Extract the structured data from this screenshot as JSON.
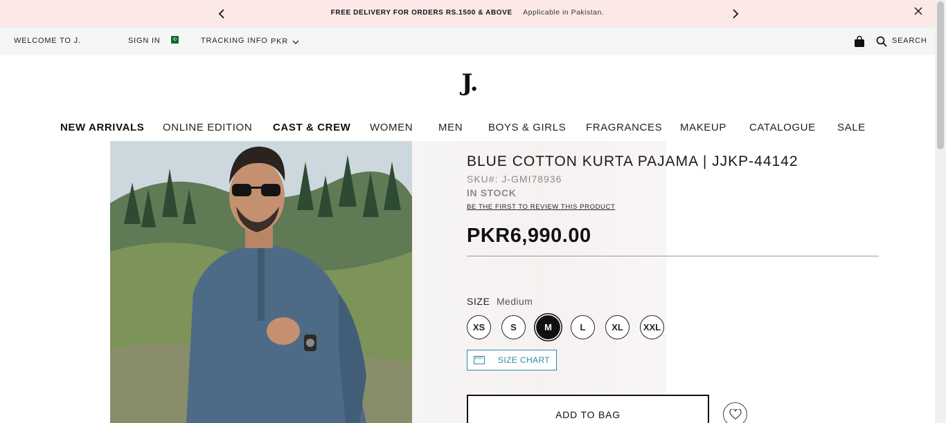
{
  "promo": {
    "message_bold": "FREE DELIVERY FOR ORDERS RS.1500 & ABOVE",
    "message_light": "Applicable in Pakistan.",
    "prev_icon": "chevron-left-icon",
    "next_icon": "chevron-right-icon",
    "close_icon": "close-icon",
    "background": "#fde8e8"
  },
  "utility": {
    "welcome": "WELCOME TO J.",
    "sign_in": "SIGN IN",
    "flag_icon": "pakistan-flag-icon",
    "tracking": "TRACKING INFO",
    "currency": "PKR",
    "bag_icon": "shopping-bag-icon",
    "search_icon": "search-icon",
    "search_label": "SEARCH"
  },
  "logo": "J.",
  "nav": [
    {
      "label": "NEW ARRIVALS",
      "bold": true
    },
    {
      "label": "ONLINE EDITION",
      "bold": false
    },
    {
      "label": "CAST & CREW",
      "bold": true
    },
    {
      "label": "WOMEN",
      "bold": false
    },
    {
      "label": "MEN",
      "bold": false
    },
    {
      "label": "BOYS & GIRLS",
      "bold": false
    },
    {
      "label": "FRAGRANCES",
      "bold": false
    },
    {
      "label": "MAKEUP",
      "bold": false
    },
    {
      "label": "CATALOGUE",
      "bold": false
    },
    {
      "label": "SALE",
      "bold": false
    }
  ],
  "product": {
    "title": "BLUE COTTON KURTA PAJAMA | JJKP-44142",
    "sku": "SKU#:  J-GMI78936",
    "stock": "IN STOCK",
    "review_link": "BE THE FIRST TO REVIEW THIS PRODUCT",
    "price": "PKR6,990.00",
    "size_label": "SIZE",
    "selected_size": "Medium",
    "sizes": [
      "XS",
      "S",
      "M",
      "L",
      "XL",
      "XXL"
    ],
    "selected_index": 2,
    "size_chart_label": "SIZE CHART",
    "size_chart_icon": "ruler-icon",
    "add_to_bag": "ADD TO BAG",
    "wishlist_icon": "heart-icon",
    "accent_color": "#2a8aa8"
  }
}
